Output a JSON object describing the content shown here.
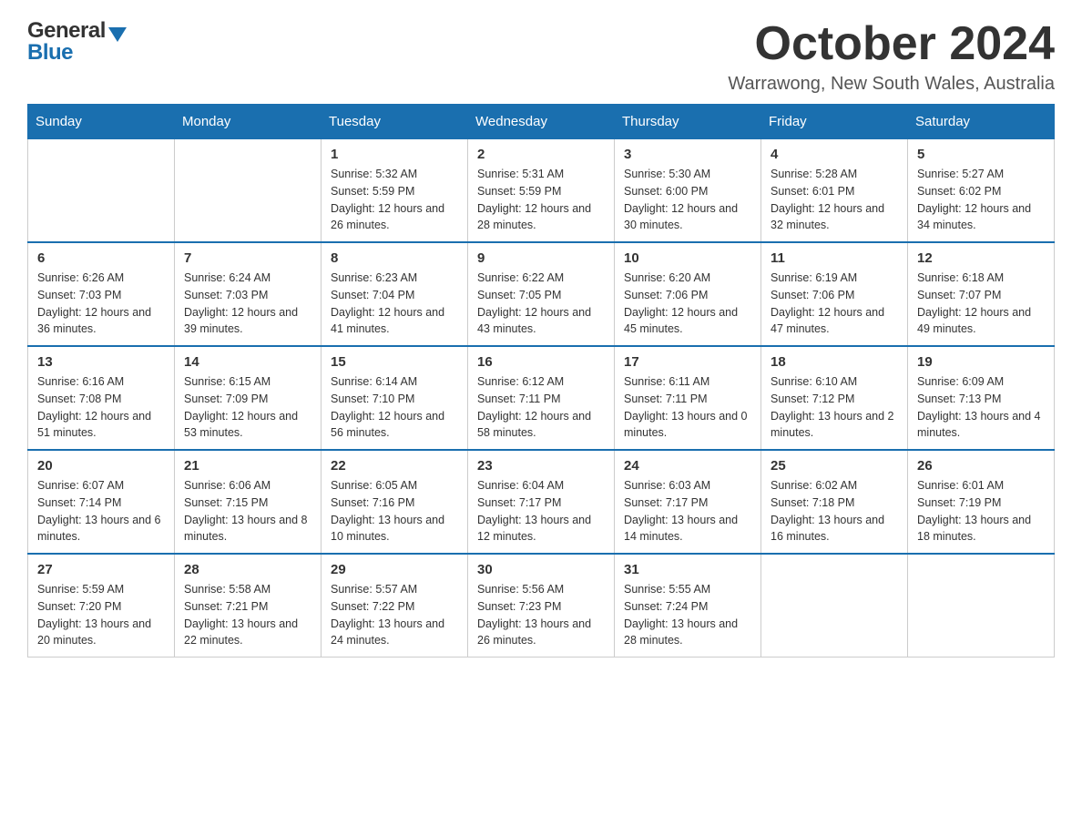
{
  "header": {
    "month_title": "October 2024",
    "location": "Warrawong, New South Wales, Australia",
    "logo_general": "General",
    "logo_blue": "Blue"
  },
  "calendar": {
    "days_of_week": [
      "Sunday",
      "Monday",
      "Tuesday",
      "Wednesday",
      "Thursday",
      "Friday",
      "Saturday"
    ],
    "weeks": [
      [
        {
          "day": "",
          "sunrise": "",
          "sunset": "",
          "daylight": ""
        },
        {
          "day": "",
          "sunrise": "",
          "sunset": "",
          "daylight": ""
        },
        {
          "day": "1",
          "sunrise": "Sunrise: 5:32 AM",
          "sunset": "Sunset: 5:59 PM",
          "daylight": "Daylight: 12 hours and 26 minutes."
        },
        {
          "day": "2",
          "sunrise": "Sunrise: 5:31 AM",
          "sunset": "Sunset: 5:59 PM",
          "daylight": "Daylight: 12 hours and 28 minutes."
        },
        {
          "day": "3",
          "sunrise": "Sunrise: 5:30 AM",
          "sunset": "Sunset: 6:00 PM",
          "daylight": "Daylight: 12 hours and 30 minutes."
        },
        {
          "day": "4",
          "sunrise": "Sunrise: 5:28 AM",
          "sunset": "Sunset: 6:01 PM",
          "daylight": "Daylight: 12 hours and 32 minutes."
        },
        {
          "day": "5",
          "sunrise": "Sunrise: 5:27 AM",
          "sunset": "Sunset: 6:02 PM",
          "daylight": "Daylight: 12 hours and 34 minutes."
        }
      ],
      [
        {
          "day": "6",
          "sunrise": "Sunrise: 6:26 AM",
          "sunset": "Sunset: 7:03 PM",
          "daylight": "Daylight: 12 hours and 36 minutes."
        },
        {
          "day": "7",
          "sunrise": "Sunrise: 6:24 AM",
          "sunset": "Sunset: 7:03 PM",
          "daylight": "Daylight: 12 hours and 39 minutes."
        },
        {
          "day": "8",
          "sunrise": "Sunrise: 6:23 AM",
          "sunset": "Sunset: 7:04 PM",
          "daylight": "Daylight: 12 hours and 41 minutes."
        },
        {
          "day": "9",
          "sunrise": "Sunrise: 6:22 AM",
          "sunset": "Sunset: 7:05 PM",
          "daylight": "Daylight: 12 hours and 43 minutes."
        },
        {
          "day": "10",
          "sunrise": "Sunrise: 6:20 AM",
          "sunset": "Sunset: 7:06 PM",
          "daylight": "Daylight: 12 hours and 45 minutes."
        },
        {
          "day": "11",
          "sunrise": "Sunrise: 6:19 AM",
          "sunset": "Sunset: 7:06 PM",
          "daylight": "Daylight: 12 hours and 47 minutes."
        },
        {
          "day": "12",
          "sunrise": "Sunrise: 6:18 AM",
          "sunset": "Sunset: 7:07 PM",
          "daylight": "Daylight: 12 hours and 49 minutes."
        }
      ],
      [
        {
          "day": "13",
          "sunrise": "Sunrise: 6:16 AM",
          "sunset": "Sunset: 7:08 PM",
          "daylight": "Daylight: 12 hours and 51 minutes."
        },
        {
          "day": "14",
          "sunrise": "Sunrise: 6:15 AM",
          "sunset": "Sunset: 7:09 PM",
          "daylight": "Daylight: 12 hours and 53 minutes."
        },
        {
          "day": "15",
          "sunrise": "Sunrise: 6:14 AM",
          "sunset": "Sunset: 7:10 PM",
          "daylight": "Daylight: 12 hours and 56 minutes."
        },
        {
          "day": "16",
          "sunrise": "Sunrise: 6:12 AM",
          "sunset": "Sunset: 7:11 PM",
          "daylight": "Daylight: 12 hours and 58 minutes."
        },
        {
          "day": "17",
          "sunrise": "Sunrise: 6:11 AM",
          "sunset": "Sunset: 7:11 PM",
          "daylight": "Daylight: 13 hours and 0 minutes."
        },
        {
          "day": "18",
          "sunrise": "Sunrise: 6:10 AM",
          "sunset": "Sunset: 7:12 PM",
          "daylight": "Daylight: 13 hours and 2 minutes."
        },
        {
          "day": "19",
          "sunrise": "Sunrise: 6:09 AM",
          "sunset": "Sunset: 7:13 PM",
          "daylight": "Daylight: 13 hours and 4 minutes."
        }
      ],
      [
        {
          "day": "20",
          "sunrise": "Sunrise: 6:07 AM",
          "sunset": "Sunset: 7:14 PM",
          "daylight": "Daylight: 13 hours and 6 minutes."
        },
        {
          "day": "21",
          "sunrise": "Sunrise: 6:06 AM",
          "sunset": "Sunset: 7:15 PM",
          "daylight": "Daylight: 13 hours and 8 minutes."
        },
        {
          "day": "22",
          "sunrise": "Sunrise: 6:05 AM",
          "sunset": "Sunset: 7:16 PM",
          "daylight": "Daylight: 13 hours and 10 minutes."
        },
        {
          "day": "23",
          "sunrise": "Sunrise: 6:04 AM",
          "sunset": "Sunset: 7:17 PM",
          "daylight": "Daylight: 13 hours and 12 minutes."
        },
        {
          "day": "24",
          "sunrise": "Sunrise: 6:03 AM",
          "sunset": "Sunset: 7:17 PM",
          "daylight": "Daylight: 13 hours and 14 minutes."
        },
        {
          "day": "25",
          "sunrise": "Sunrise: 6:02 AM",
          "sunset": "Sunset: 7:18 PM",
          "daylight": "Daylight: 13 hours and 16 minutes."
        },
        {
          "day": "26",
          "sunrise": "Sunrise: 6:01 AM",
          "sunset": "Sunset: 7:19 PM",
          "daylight": "Daylight: 13 hours and 18 minutes."
        }
      ],
      [
        {
          "day": "27",
          "sunrise": "Sunrise: 5:59 AM",
          "sunset": "Sunset: 7:20 PM",
          "daylight": "Daylight: 13 hours and 20 minutes."
        },
        {
          "day": "28",
          "sunrise": "Sunrise: 5:58 AM",
          "sunset": "Sunset: 7:21 PM",
          "daylight": "Daylight: 13 hours and 22 minutes."
        },
        {
          "day": "29",
          "sunrise": "Sunrise: 5:57 AM",
          "sunset": "Sunset: 7:22 PM",
          "daylight": "Daylight: 13 hours and 24 minutes."
        },
        {
          "day": "30",
          "sunrise": "Sunrise: 5:56 AM",
          "sunset": "Sunset: 7:23 PM",
          "daylight": "Daylight: 13 hours and 26 minutes."
        },
        {
          "day": "31",
          "sunrise": "Sunrise: 5:55 AM",
          "sunset": "Sunset: 7:24 PM",
          "daylight": "Daylight: 13 hours and 28 minutes."
        },
        {
          "day": "",
          "sunrise": "",
          "sunset": "",
          "daylight": ""
        },
        {
          "day": "",
          "sunrise": "",
          "sunset": "",
          "daylight": ""
        }
      ]
    ]
  }
}
